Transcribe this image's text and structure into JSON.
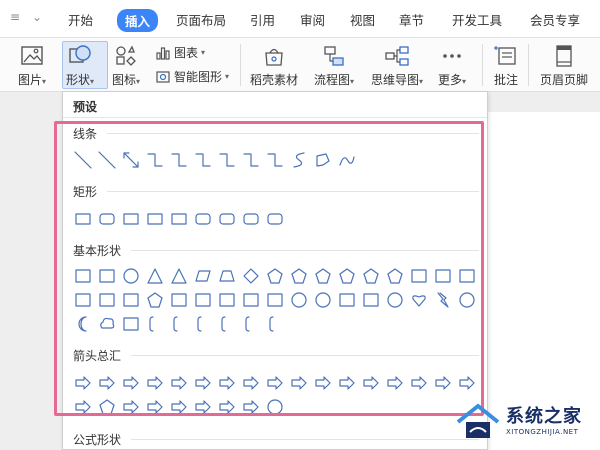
{
  "tabs": [
    "开始",
    "插入",
    "页面布局",
    "引用",
    "审阅",
    "视图",
    "章节",
    "开发工具",
    "会员专享"
  ],
  "active_tab": "插入",
  "ribbon": {
    "picture": "图片",
    "shape": "形状",
    "icon": "图标",
    "chart": "图表",
    "smart_graphic": "智能图形",
    "daoke_material": "稻壳素材",
    "flowchart": "流程图",
    "mindmap": "思维导图",
    "more": "更多",
    "comment": "批注",
    "header_footer": "页眉页脚"
  },
  "dropdown": {
    "header": "预设",
    "categories": [
      {
        "label": "线条",
        "icons": [
          "line-icon",
          "arrow-line-icon",
          "double-arrow-line-icon",
          "elbow-connector-icon",
          "elbow-arrow-connector-icon",
          "elbow-double-arrow-connector-icon",
          "curved-connector-icon",
          "curved-arrow-connector-icon",
          "curved-double-arrow-connector-icon",
          "curve-icon",
          "freeform-icon",
          "scribble-icon"
        ]
      },
      {
        "label": "矩形",
        "icons": [
          "rectangle-icon",
          "rounded-rectangle-icon",
          "snip-single-corner-rectangle-icon",
          "snip-same-side-rectangle-icon",
          "snip-diagonal-rectangle-icon",
          "snip-round-rectangle-icon",
          "round-single-corner-rectangle-icon",
          "round-same-side-rectangle-icon",
          "round-diagonal-rectangle-icon"
        ]
      },
      {
        "label": "基本形状",
        "icons": []
      },
      {
        "label": "箭头总汇",
        "icons": []
      },
      {
        "label": "公式形状",
        "icons": []
      }
    ]
  },
  "basic_shape_rows": [
    [
      "text-box-icon",
      "vertical-text-box-icon",
      "oval-icon",
      "triangle-icon",
      "right-triangle-icon",
      "parallelogram-icon",
      "trapezoid-icon",
      "diamond-icon",
      "pentagon-icon",
      "hexagon-icon",
      "heptagon-icon",
      "octagon-icon",
      "decagon-icon",
      "dodecagon-icon",
      "pie-icon",
      "chord-icon",
      "teardrop-icon"
    ],
    [
      "frame-icon",
      "half-frame-icon",
      "l-shape-icon",
      "diagonal-stripe-icon",
      "cross-icon",
      "plaque-icon",
      "can-icon",
      "cube-icon",
      "bevel-icon",
      "donut-icon",
      "no-symbol-icon",
      "block-arc-icon",
      "folded-corner-icon",
      "smiley-face-icon",
      "heart-icon",
      "lightning-bolt-icon",
      "sun-icon"
    ],
    [
      "moon-icon",
      "cloud-icon",
      "arc-icon",
      "double-bracket-icon",
      "double-brace-icon",
      "left-bracket-icon",
      "right-bracket-icon",
      "left-brace-icon",
      "right-brace-icon"
    ]
  ],
  "arrow_rows": [
    [
      "right-arrow-icon",
      "left-arrow-icon",
      "up-arrow-icon",
      "down-arrow-icon",
      "left-right-arrow-icon",
      "up-down-arrow-icon",
      "quad-arrow-icon",
      "left-right-up-arrow-icon",
      "bent-arrow-icon",
      "u-turn-arrow-icon",
      "left-up-arrow-icon",
      "bent-up-arrow-icon",
      "curved-right-arrow-icon",
      "curved-left-arrow-icon",
      "curved-up-arrow-icon",
      "curved-down-arrow-icon",
      "striped-right-arrow-icon"
    ],
    [
      "notched-right-arrow-icon",
      "pentagon-arrow-icon",
      "chevron-arrow-icon",
      "right-arrow-callout-icon",
      "left-arrow-callout-icon",
      "up-arrow-callout-icon",
      "down-arrow-callout-icon",
      "quad-arrow-callout-icon",
      "circular-arrow-icon"
    ]
  ],
  "watermark": {
    "title": "系统之家",
    "subtitle": "XITONGZHIJIA.NET"
  },
  "colors": {
    "accent": "#3b85f6",
    "shape_stroke": "#4a72b8",
    "highlight": "#e56a93"
  }
}
